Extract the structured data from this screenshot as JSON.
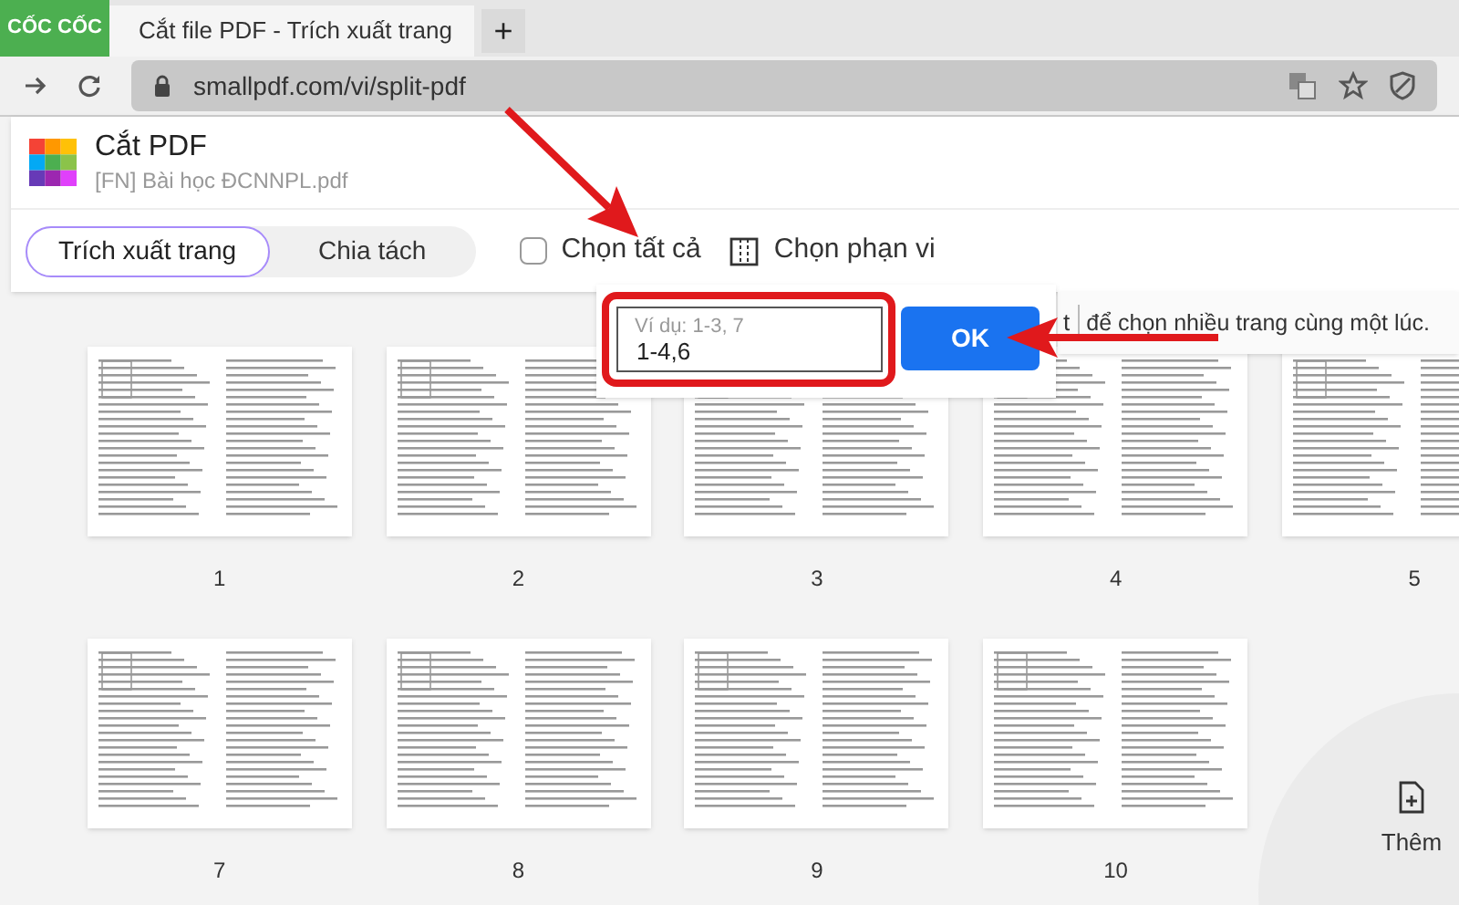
{
  "browser": {
    "brand": "CỐC CỐC",
    "tab_title": "Cắt file PDF - Trích xuất trang",
    "new_tab": "+",
    "url": "smallpdf.com/vi/split-pdf"
  },
  "header": {
    "title": "Cắt PDF",
    "file_name": "[FN] Bài học ĐCNNPL.pdf"
  },
  "modes": [
    {
      "label": "Trích xuất trang",
      "selected": true
    },
    {
      "label": "Chia tách",
      "selected": false
    }
  ],
  "select_all": {
    "label": "Chọn tất cả",
    "checked": false
  },
  "select_range": {
    "label": "Chọn phạn vi"
  },
  "range_popup": {
    "placeholder": "Ví dụ: 1-3, 7",
    "value": "1-4,6",
    "button": "OK"
  },
  "hint": {
    "key": "t",
    "text": "để chọn nhiều trang cùng một lúc."
  },
  "pages": [
    {
      "number": "1"
    },
    {
      "number": "2"
    },
    {
      "number": "3"
    },
    {
      "number": "4"
    },
    {
      "number": "5"
    },
    {
      "number": "7"
    },
    {
      "number": "8"
    },
    {
      "number": "9"
    },
    {
      "number": "10"
    }
  ],
  "add_button": {
    "label": "Thêm"
  }
}
